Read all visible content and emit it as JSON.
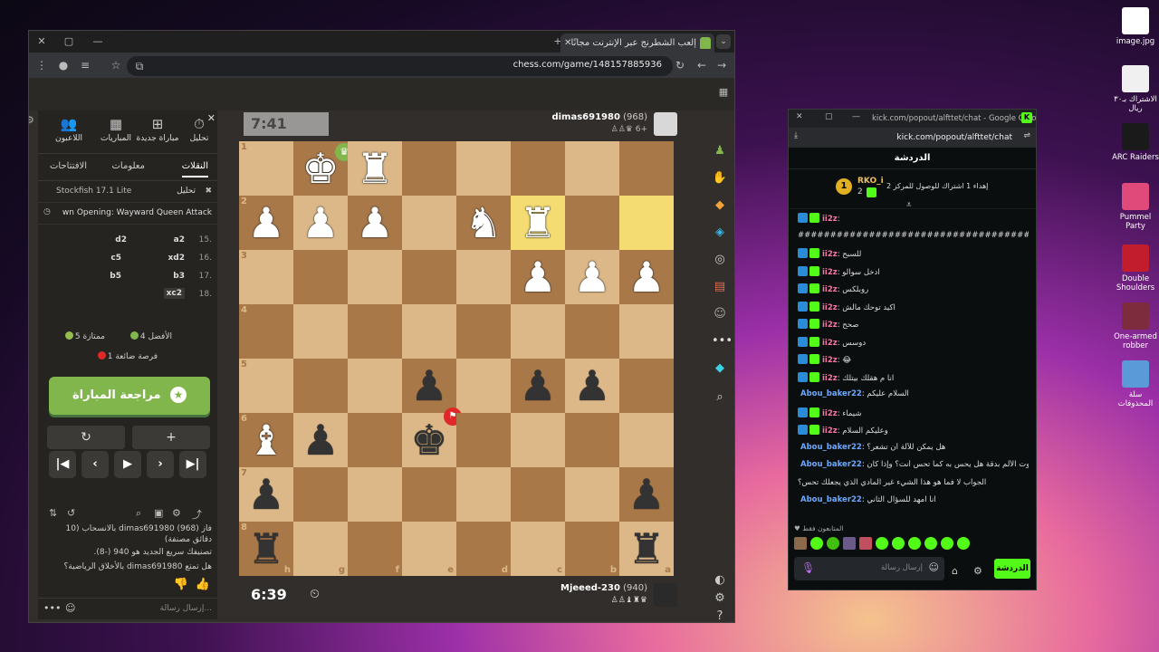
{
  "chess_browser": {
    "tab_title": "إلعب الشطرنج عبر الإنترنت مجانًا",
    "url": "chess.com/game/148157885936"
  },
  "left_panel": {
    "top_icons": [
      {
        "label": "تحليل",
        "icon": "stopwatch-icon"
      },
      {
        "label": "مباراة جديدة",
        "icon": "plus-icon"
      },
      {
        "label": "المباريات",
        "icon": "board-icon"
      },
      {
        "label": "اللاعبون",
        "icon": "players-icon"
      }
    ],
    "tabs": [
      "النقلات",
      "معلومات",
      "الافتتاحات"
    ],
    "engine_label": "تحليل",
    "engine_name": "Stockfish 17.1 Lite",
    "opening": "wn Opening: Wayward Queen Attack",
    "moves": [
      {
        "num": "15.",
        "white": "a2",
        "black": "d2"
      },
      {
        "num": "16.",
        "white": "xd2",
        "black": "c5"
      },
      {
        "num": "17.",
        "white": "b3",
        "black": "b5"
      },
      {
        "num": "18.",
        "white": "xc2",
        "black": ""
      }
    ],
    "stats": {
      "best": "4 الأفضل",
      "excellent": "5 ممتازة",
      "missed": "1 فرصة ضائعة"
    },
    "review_button": "مراجعة المباراة",
    "chat_lines": [
      "فاز dimas691980 (968) بالانسحاب (10 دقائق مصنفة)",
      "تصنيفك سريع الجديد هو 940 (-8).",
      "هل تمتع dimas691980 بالأخلاق الرياضية؟"
    ],
    "chat_placeholder": "إرسال رسالة..."
  },
  "board": {
    "ranks": [
      "1",
      "2",
      "3",
      "4",
      "5",
      "6",
      "7",
      "8"
    ],
    "files": [
      "h",
      "g",
      "f",
      "e",
      "d",
      "c",
      "b",
      "a"
    ],
    "highlight_squares": [
      [
        1,
        5
      ],
      [
        1,
        7
      ]
    ],
    "pieces": [
      {
        "r": 0,
        "c": 1,
        "p": "♚",
        "color": "w"
      },
      {
        "r": 0,
        "c": 2,
        "p": "♜",
        "color": "w"
      },
      {
        "r": 1,
        "c": 0,
        "p": "♟",
        "color": "w"
      },
      {
        "r": 1,
        "c": 1,
        "p": "♟",
        "color": "w"
      },
      {
        "r": 1,
        "c": 2,
        "p": "♟",
        "color": "w"
      },
      {
        "r": 1,
        "c": 4,
        "p": "♞",
        "color": "w"
      },
      {
        "r": 1,
        "c": 5,
        "p": "♜",
        "color": "w"
      },
      {
        "r": 2,
        "c": 5,
        "p": "♟",
        "color": "w"
      },
      {
        "r": 2,
        "c": 6,
        "p": "♟",
        "color": "w"
      },
      {
        "r": 2,
        "c": 7,
        "p": "♟",
        "color": "w"
      },
      {
        "r": 4,
        "c": 3,
        "p": "♟",
        "color": "b"
      },
      {
        "r": 4,
        "c": 5,
        "p": "♟",
        "color": "b"
      },
      {
        "r": 4,
        "c": 6,
        "p": "♟",
        "color": "b"
      },
      {
        "r": 5,
        "c": 0,
        "p": "♝",
        "color": "w"
      },
      {
        "r": 5,
        "c": 1,
        "p": "♟",
        "color": "b"
      },
      {
        "r": 5,
        "c": 3,
        "p": "♚",
        "color": "b"
      },
      {
        "r": 6,
        "c": 0,
        "p": "♟",
        "color": "b"
      },
      {
        "r": 6,
        "c": 7,
        "p": "♟",
        "color": "b"
      },
      {
        "r": 7,
        "c": 0,
        "p": "♜",
        "color": "b"
      },
      {
        "r": 7,
        "c": 7,
        "p": "♜",
        "color": "b"
      }
    ]
  },
  "top_player": {
    "name": "dimas691980",
    "rating": "(968)",
    "material": "+6",
    "clock": "7:41"
  },
  "bottom_player": {
    "name": "Mjeeed-230",
    "rating": "(940)",
    "clock": "6:39"
  },
  "kick": {
    "window_title": "kick.com/popout/alfttet/chat - Google Chrome",
    "url": "kick.com/popout/alfttet/chat",
    "header": "الدردشة",
    "pinned_user": "RKO_i",
    "pinned_text": "إهداء 1 اشتراك للوصول للمركز 2",
    "pinned_level": "2",
    "pinned_rank": "1",
    "messages": [
      {
        "user": "ii2z",
        "text": "",
        "color": "pink"
      },
      {
        "user": "",
        "text": "#####################################",
        "color": "none"
      },
      {
        "user": "ii2z",
        "text": "للسبح",
        "color": "pink"
      },
      {
        "user": "ii2z",
        "text": "ادخل سوالو",
        "color": "pink"
      },
      {
        "user": "ii2z",
        "text": "روبلكس",
        "color": "pink"
      },
      {
        "user": "ii2z",
        "text": "اكيد توحك مالش",
        "color": "pink"
      },
      {
        "user": "ii2z",
        "text": "صحح",
        "color": "pink"
      },
      {
        "user": "ii2z",
        "text": "دوسس",
        "color": "pink"
      },
      {
        "user": "ii2z",
        "text": "😂",
        "color": "pink"
      },
      {
        "user": "ii2z",
        "text": "انا م هقلك بيتلك",
        "color": "pink"
      },
      {
        "user": "Abou_baker22",
        "text": "السلام عليكم",
        "color": "blue"
      },
      {
        "user": "ii2z",
        "text": "شيماء",
        "color": "pink"
      },
      {
        "user": "ii2z",
        "text": "وعليكم السلام",
        "color": "pink"
      },
      {
        "user": "Abou_baker22",
        "text": "هل يمكن للآلة أن تشعر؟",
        "color": "blue"
      },
      {
        "user": "Abou_baker22",
        "text": "لو قلد الروبوت الألم بدقة هل يحس به كما تحس أنت؟ وإذا كان",
        "color": "blue"
      },
      {
        "user": "",
        "text": "الجواب لا فما هو هذا الشيء غير المادي الذي يجعلك تحس؟",
        "color": "none"
      },
      {
        "user": "Abou_baker22",
        "text": "انا امهد للسؤال الثاني",
        "color": "blue"
      }
    ],
    "supporters_label": "المتابعون فقط",
    "input_placeholder": "إرسال رسالة",
    "send_label": "الدردشة"
  },
  "desktop_icons": [
    {
      "label": "image.jpg",
      "color": "#ffffff"
    },
    {
      "label": "الاشتراك بـ٣٠ ريال",
      "color": "#f0f0f0"
    },
    {
      "label": "ARC Raiders",
      "color": "#1a1a1a"
    },
    {
      "label": "Pummel Party",
      "color": "#e04a7a"
    },
    {
      "label": "Double Shoulders",
      "color": "#c21d2d"
    },
    {
      "label": "One-armed robber",
      "color": "#7c2c3c"
    },
    {
      "label": "سلة المحذوفات",
      "color": "#5a9ad8"
    }
  ]
}
